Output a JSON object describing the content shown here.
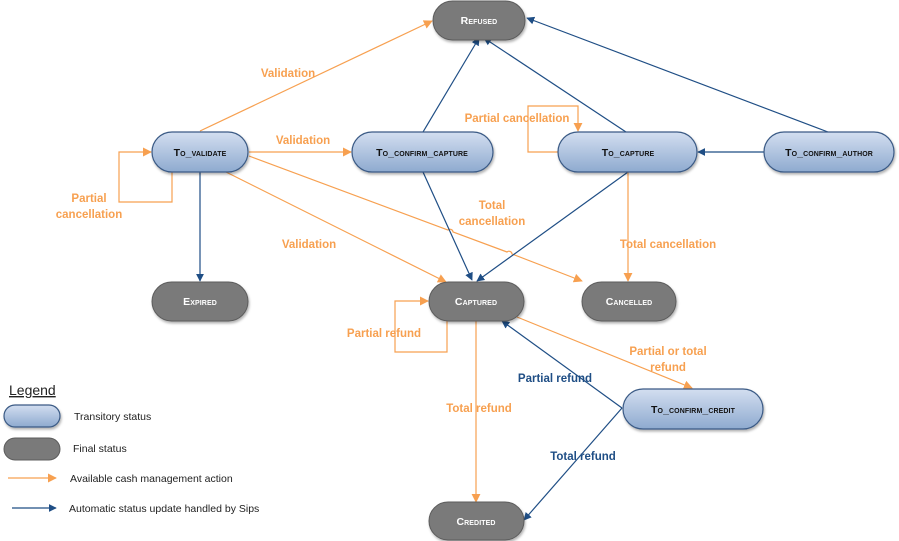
{
  "colors": {
    "action": "#f7a050",
    "automatic": "#1f4e85",
    "transitory_fill_top": "#cfdcec",
    "transitory_fill_bottom": "#8fabd0",
    "transitory_stroke": "#3a5a85",
    "final_fill": "#7a7a7a",
    "final_stroke": "#5a5a5a"
  },
  "nodes": {
    "refused": {
      "label": "Refused",
      "type": "final"
    },
    "to_validate": {
      "label": "To_validate",
      "type": "transitory"
    },
    "to_confirm_capture": {
      "label": "To_confirm_capture",
      "type": "transitory"
    },
    "to_capture": {
      "label": "To_capture",
      "type": "transitory"
    },
    "to_confirm_author": {
      "label": "To_confirm_author",
      "type": "transitory"
    },
    "expired": {
      "label": "Expired",
      "type": "final"
    },
    "captured": {
      "label": "Captured",
      "type": "final"
    },
    "cancelled": {
      "label": "Cancelled",
      "type": "final"
    },
    "to_confirm_credit": {
      "label": "To_confirm_credit",
      "type": "transitory"
    },
    "credited": {
      "label": "Credited",
      "type": "final"
    }
  },
  "edges": [
    {
      "from": "to_validate",
      "to": "refused",
      "kind": "action",
      "label": "Validation"
    },
    {
      "from": "to_validate",
      "to": "to_confirm_capture",
      "kind": "action",
      "label": "Validation"
    },
    {
      "from": "to_validate",
      "to": "to_validate",
      "kind": "action",
      "label": "Partial cancellation"
    },
    {
      "from": "to_validate",
      "to": "captured",
      "kind": "action",
      "label": "Validation"
    },
    {
      "from": "to_validate",
      "to": "cancelled",
      "kind": "action",
      "label": "Total cancellation"
    },
    {
      "from": "to_validate",
      "to": "expired",
      "kind": "automatic",
      "label": ""
    },
    {
      "from": "to_confirm_capture",
      "to": "refused",
      "kind": "automatic",
      "label": ""
    },
    {
      "from": "to_confirm_capture",
      "to": "captured",
      "kind": "automatic",
      "label": ""
    },
    {
      "from": "to_capture",
      "to": "refused",
      "kind": "automatic",
      "label": ""
    },
    {
      "from": "to_capture",
      "to": "to_capture",
      "kind": "action",
      "label": "Partial cancellation"
    },
    {
      "from": "to_capture",
      "to": "captured",
      "kind": "automatic",
      "label": ""
    },
    {
      "from": "to_capture",
      "to": "cancelled",
      "kind": "action",
      "label": "Total cancellation"
    },
    {
      "from": "to_confirm_author",
      "to": "refused",
      "kind": "automatic",
      "label": ""
    },
    {
      "from": "to_confirm_author",
      "to": "to_capture",
      "kind": "automatic",
      "label": ""
    },
    {
      "from": "captured",
      "to": "captured",
      "kind": "action",
      "label": "Partial refund"
    },
    {
      "from": "captured",
      "to": "credited",
      "kind": "action",
      "label": "Total refund"
    },
    {
      "from": "captured",
      "to": "to_confirm_credit",
      "kind": "action",
      "label": "Partial or total refund"
    },
    {
      "from": "to_confirm_credit",
      "to": "captured",
      "kind": "automatic",
      "label": "Partial refund"
    },
    {
      "from": "to_confirm_credit",
      "to": "credited",
      "kind": "automatic",
      "label": "Total refund"
    }
  ],
  "edge_labels": {
    "validation_refused": "Validation",
    "validation_confirm_capture": "Validation",
    "validation_captured": "Validation",
    "partial_cancellation_validate_1": "Partial",
    "partial_cancellation_validate_2": "cancellation",
    "total_cancellation_1": "Total",
    "total_cancellation_2": "cancellation",
    "partial_cancellation_capture": "Partial cancellation",
    "total_cancellation_capture": "Total cancellation",
    "partial_refund_loop": "Partial refund",
    "total_refund_action": "Total refund",
    "partial_or_total_1": "Partial or total",
    "partial_or_total_2": "refund",
    "partial_refund_auto": "Partial refund",
    "total_refund_auto": "Total refund"
  },
  "legend": {
    "title": "Legend",
    "items": [
      {
        "kind": "transitory",
        "label": "Transitory status"
      },
      {
        "kind": "final",
        "label": "Final status"
      },
      {
        "kind": "action",
        "label": "Available cash management action"
      },
      {
        "kind": "automatic",
        "label": "Automatic status update handled by Sips"
      }
    ]
  }
}
